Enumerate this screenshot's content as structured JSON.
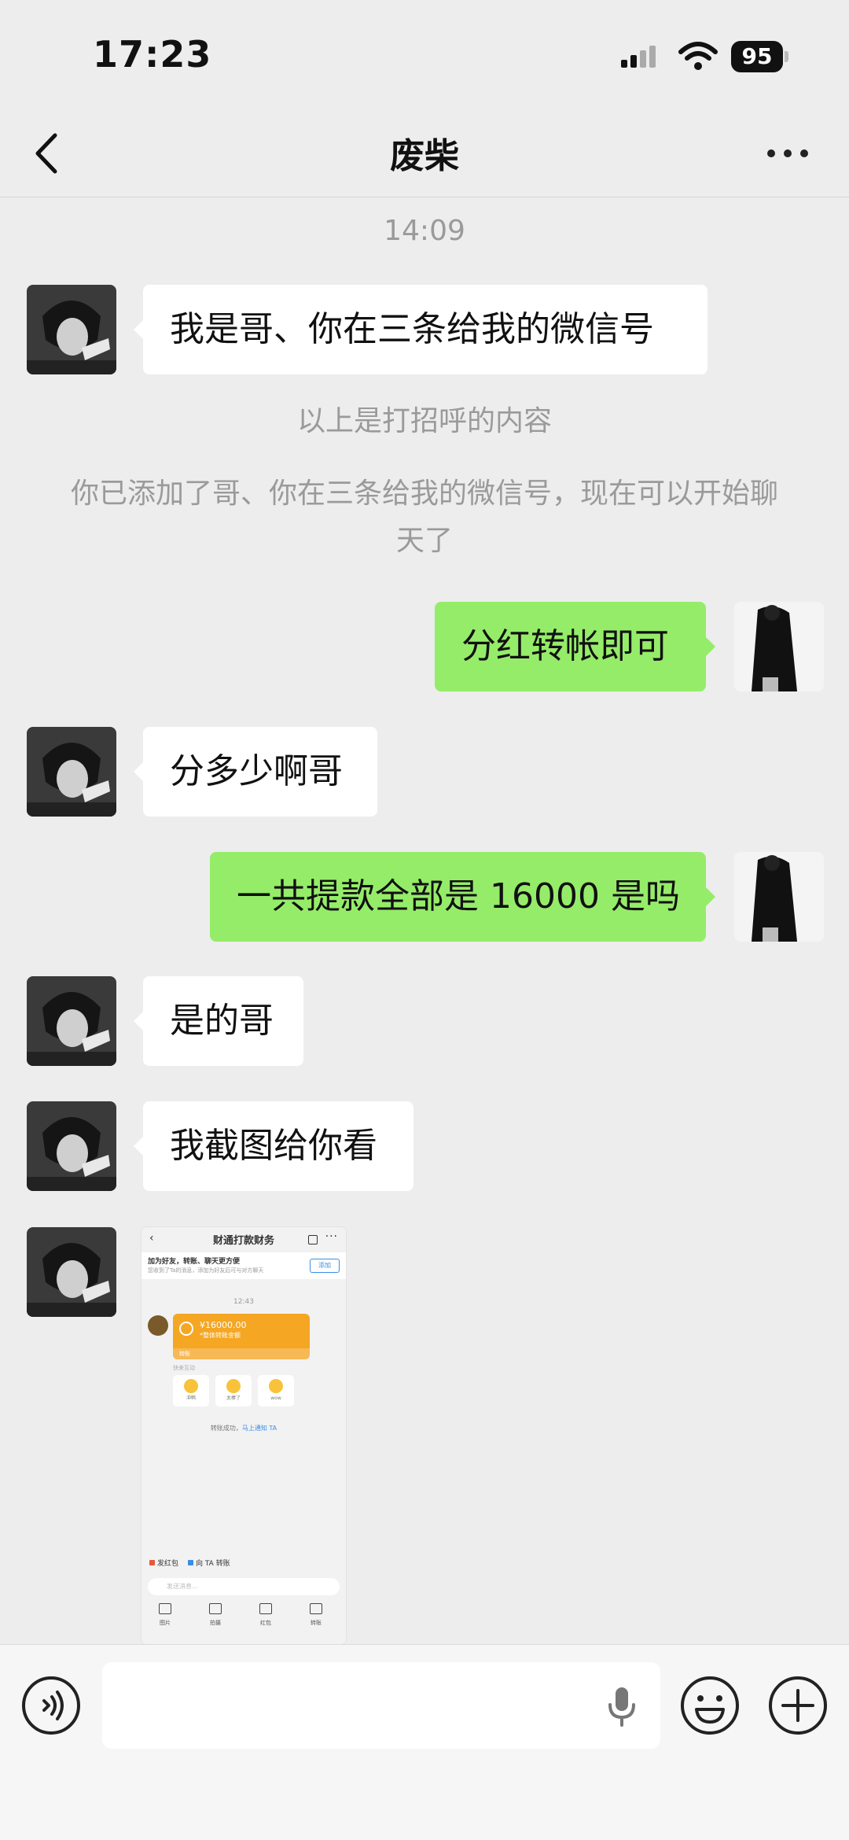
{
  "status_bar": {
    "time": "17:23",
    "battery": "95",
    "signal_icon": "cellular-signal-icon",
    "wifi_icon": "wifi-icon",
    "battery_icon": "battery-icon"
  },
  "nav": {
    "back_icon": "chevron-left-icon",
    "title": "废柴",
    "more_icon": "more-dots-icon"
  },
  "chat": {
    "timestamp": "14:09",
    "greeting_message": "我是哥、你在三条给我的微信号",
    "system_note_1": "以上是打招呼的内容",
    "system_note_2": "你已添加了哥、你在三条给我的微信号，现在可以开始聊天了",
    "messages": [
      {
        "from": "me",
        "text": "分红转帐即可"
      },
      {
        "from": "them",
        "text": "分多少啊哥"
      },
      {
        "from": "me",
        "text": "一共提款全部是 16000 是吗"
      },
      {
        "from": "them",
        "text": "是的哥"
      },
      {
        "from": "them",
        "text": "我截图给你看"
      }
    ],
    "image_message": {
      "header_title": "财通打款财务",
      "banner_line1": "加为好友，转账、聊天更方便",
      "banner_line2": "您收到了Ta的消息，添加为好友后可与对方聊天",
      "banner_button": "添加",
      "time": "12:43",
      "amount": "¥16000.00",
      "amount_note": "*整体转账金额",
      "card_footer": "转账",
      "emoji_caption": "快来互动",
      "emoji_labels": [
        "冲鸭",
        "太棒了",
        "wow"
      ],
      "transfer_success": "转账成功，",
      "notify_link": "马上通知 TA",
      "quick_red_packet": "发红包",
      "quick_transfer": "向 TA 转账",
      "input_placeholder": "发送消息...",
      "toolbar": [
        "图片",
        "拍摄",
        "红包",
        "转账"
      ]
    }
  },
  "input_bar": {
    "voice_icon": "voice-input-icon",
    "mic_icon": "microphone-icon",
    "emoji_icon": "emoji-icon",
    "plus_icon": "plus-circle-icon"
  }
}
